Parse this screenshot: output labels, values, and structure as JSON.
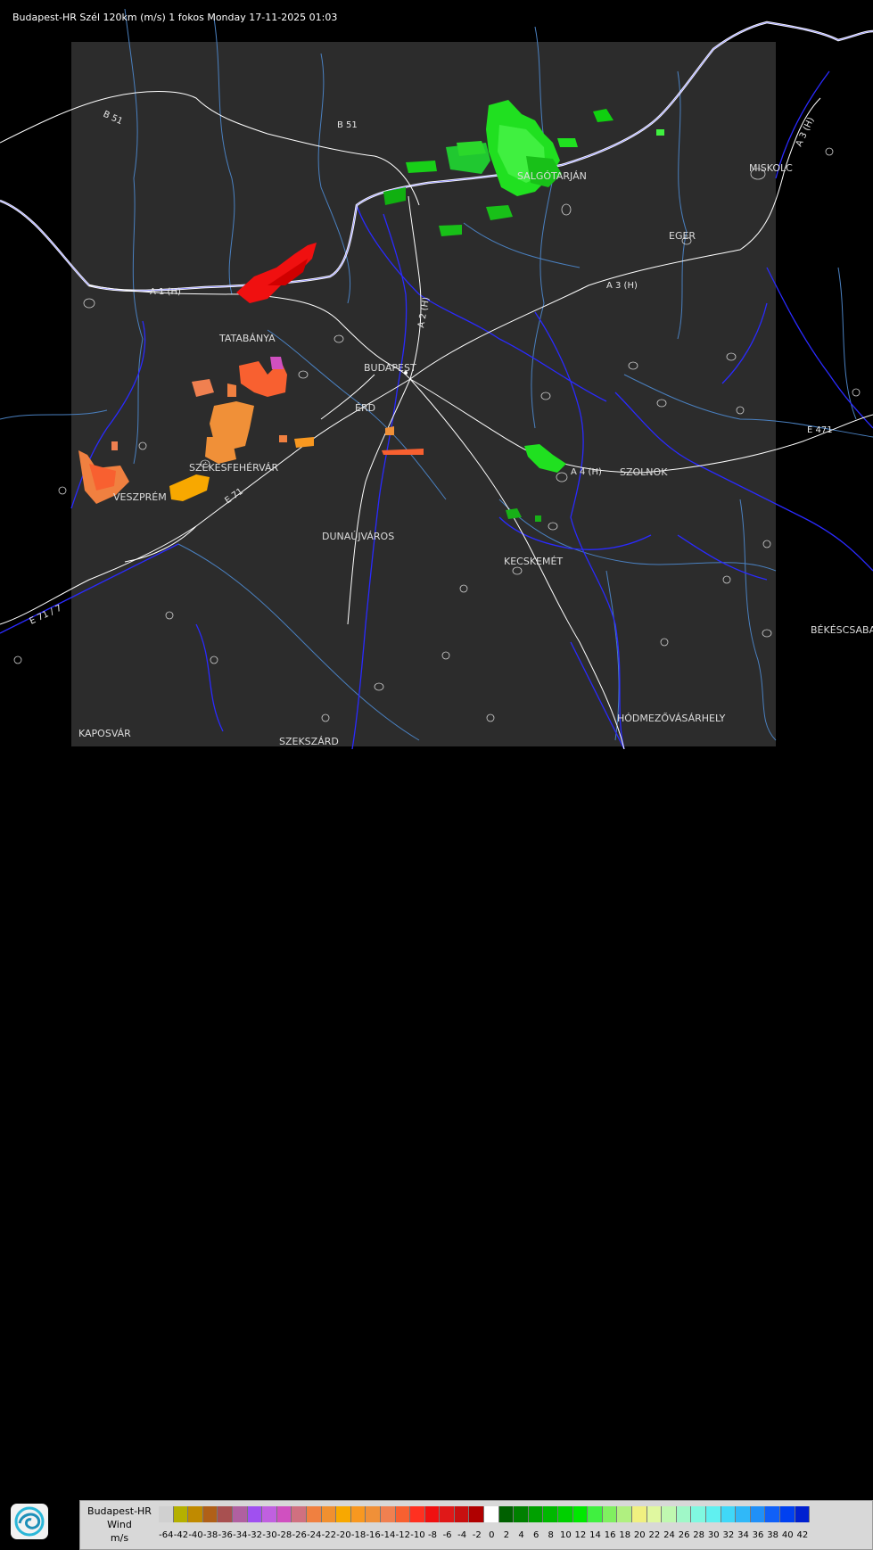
{
  "header": {
    "title": "Budapest-HR Szél 120km (m/s) 1 fokos Monday 17-11-2025 01:03"
  },
  "cities": {
    "salgotarjan": "SALGÓTARJÁN",
    "miskolc": "MISKOLC",
    "eger": "EGER",
    "tatabanya": "TATABÁNYA",
    "budapest": "BUDAPEST",
    "erd": "ÉRD",
    "szolnok": "SZOLNOK",
    "szekesfehervar": "SZÉKESFEHÉRVÁR",
    "veszprem": "VESZPRÉM",
    "dunaujvaros": "DUNAÚJVÁROS",
    "kecskemet": "KECSKEMÉT",
    "bekescsaba": "BÉKÉSCSABA",
    "hodmezovasarhely": "HÓDMEZŐVÁSÁRHELY",
    "kaposvar": "KAPOSVÁR",
    "szekszard": "SZEKSZÁRD"
  },
  "roads": {
    "b51_west": "B 51",
    "b51_north": "B 51",
    "a1": "A 1 (H)",
    "a2": "A 2 (H)",
    "a3": "A 3 (H)",
    "a3_ne": "A 3 (H)",
    "a4": "A 4 (H)",
    "e71": "E 71",
    "e71_sw": "E 71 / 7",
    "e471": "E 471"
  },
  "legend": {
    "title_line1": "Budapest-HR",
    "title_line2": "Wind",
    "title_line3": "m/s",
    "ticks": [
      "-64",
      "-42",
      "-40",
      "-38",
      "-36",
      "-34",
      "-32",
      "-30",
      "-28",
      "-26",
      "-24",
      "-22",
      "-20",
      "-18",
      "-16",
      "-14",
      "-12",
      "-10",
      "-8",
      "-6",
      "-4",
      "-2",
      "0",
      "2",
      "4",
      "6",
      "8",
      "10",
      "12",
      "14",
      "16",
      "18",
      "20",
      "22",
      "24",
      "26",
      "28",
      "30",
      "32",
      "34",
      "36",
      "38",
      "40",
      "42"
    ],
    "colors": [
      "#d0d0d0",
      "#b5b000",
      "#c08a00",
      "#b06018",
      "#a85050",
      "#b060a0",
      "#a050f0",
      "#c060e0",
      "#d050c0",
      "#d07080",
      "#f08040",
      "#f09030",
      "#f8a800",
      "#f89820",
      "#f09038",
      "#f08050",
      "#f86030",
      "#ff3020",
      "#f01010",
      "#e01818",
      "#c81010",
      "#b00000",
      "#ffffff",
      "#006000",
      "#008000",
      "#00a000",
      "#00b800",
      "#00d000",
      "#00e800",
      "#40f040",
      "#80f060",
      "#b0f080",
      "#f0f080",
      "#e0f8a0",
      "#c0f8b0",
      "#a0f8c8",
      "#80f8e0",
      "#60f0f0",
      "#40d8f8",
      "#30b8f8",
      "#2090f8",
      "#1060f8",
      "#0040f0",
      "#0020d0"
    ]
  },
  "colors": {
    "background": "#000000",
    "radar_area": "#2c2c2c",
    "rivers": "#2a2aff",
    "roads": "#ffffff",
    "borders": "#5a8ac8"
  }
}
